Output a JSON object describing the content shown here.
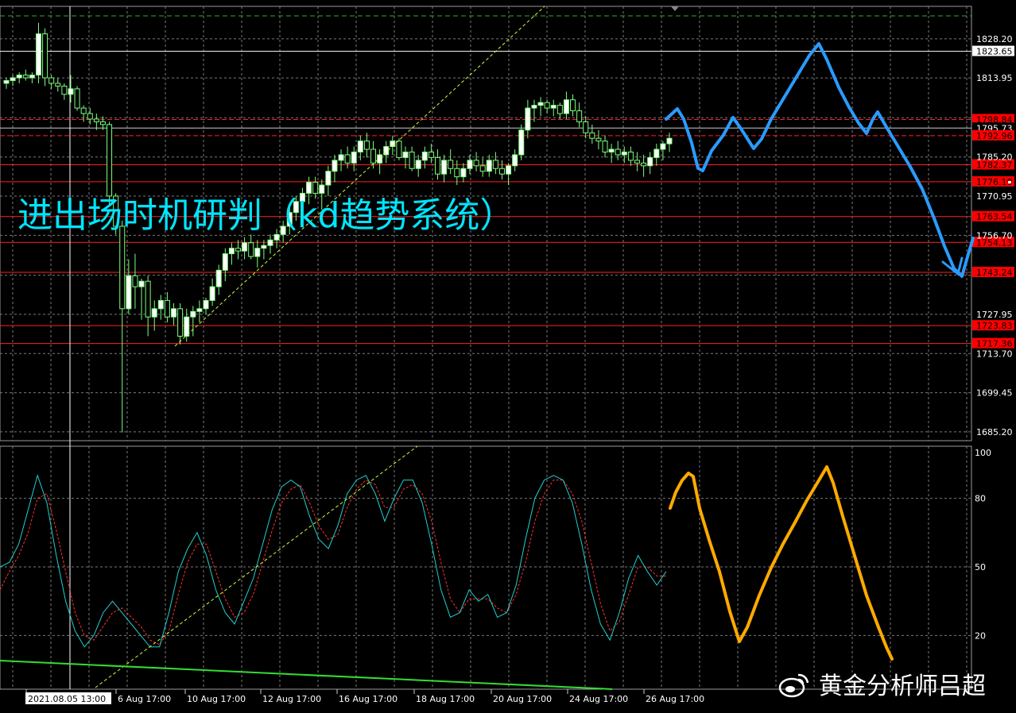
{
  "overlay_title": "进出场时机研判（kd趋势系统）",
  "watermark": "黄金分析师吕超",
  "colors": {
    "background": "#000000",
    "grid": "#7a7a7a",
    "candle": "#7dff7d",
    "candle_body_up": "#ffffff",
    "support_resistance": "#ff2020",
    "label_bg": "#ff0000",
    "current_label_bg": "#ffffff",
    "forecast_price": "#2a9bff",
    "forecast_kd": "#ffaa00",
    "kd_k": "#20d0d0",
    "kd_d": "#ff3030",
    "trendline": "#c8ff40",
    "green_line": "#33dd33",
    "overlay_text": "#00e5ff"
  },
  "chart_data": [
    {
      "type": "candlestick",
      "y_axis_ticks": [
        1828.2,
        1813.95,
        1799.45,
        1785.2,
        1770.95,
        1756.7,
        1742.2,
        1727.95,
        1713.7,
        1699.45,
        1685.2
      ],
      "y_axis_tick_labels": [
        "1828.20",
        "1813.95",
        "",
        "1785.20",
        "1770.95",
        "1756.70",
        "",
        "1727.95",
        "1713.70",
        "1699.45",
        "1685.20"
      ],
      "ylim": [
        1682,
        1840
      ],
      "x_tick_labels": [
        "2021.08.05 13:00",
        "6 Aug 17:00",
        "10 Aug 17:00",
        "12 Aug 17:00",
        "16 Aug 17:00",
        "18 Aug 17:00",
        "20 Aug 17:00",
        "24 Aug 17:00",
        "26 Aug 17:00"
      ],
      "price_levels": [
        {
          "value": 1823.65,
          "label": "1823.65",
          "style": "current"
        },
        {
          "value": 1798.84,
          "label": "1798.84",
          "style": "red"
        },
        {
          "value": 1795.73,
          "label": "1795.73",
          "style": "white"
        },
        {
          "value": 1792.96,
          "label": "1792.96",
          "style": "red"
        },
        {
          "value": 1782.37,
          "label": "1782.37",
          "style": "red"
        },
        {
          "value": 1776.19,
          "label": "1776.19",
          "style": "red"
        },
        {
          "value": 1763.54,
          "label": "1763.54",
          "style": "red"
        },
        {
          "value": 1754.13,
          "label": "1754.13",
          "style": "red"
        },
        {
          "value": 1743.24,
          "label": "1743.24",
          "style": "red"
        },
        {
          "value": 1723.83,
          "label": "1723.83",
          "style": "red"
        },
        {
          "value": 1717.36,
          "label": "1717.36",
          "style": "red"
        }
      ],
      "candles_ohlc": [
        [
          1812,
          1814,
          1810,
          1813
        ],
        [
          1813,
          1815,
          1811,
          1814
        ],
        [
          1814,
          1816,
          1812,
          1815
        ],
        [
          1815,
          1817,
          1813,
          1814
        ],
        [
          1814,
          1816,
          1812,
          1815
        ],
        [
          1815,
          1834,
          1812,
          1830
        ],
        [
          1830,
          1832,
          1811,
          1814
        ],
        [
          1814,
          1815,
          1810,
          1812
        ],
        [
          1812,
          1814,
          1809,
          1811
        ],
        [
          1811,
          1812,
          1806,
          1808
        ],
        [
          1808,
          1815,
          1805,
          1810
        ],
        [
          1810,
          1811,
          1802,
          1803
        ],
        [
          1803,
          1804,
          1798,
          1801
        ],
        [
          1801,
          1803,
          1797,
          1799
        ],
        [
          1799,
          1801,
          1795,
          1798
        ],
        [
          1798,
          1800,
          1795,
          1797
        ],
        [
          1797,
          1798,
          1768,
          1771
        ],
        [
          1771,
          1772,
          1757,
          1760
        ],
        [
          1760,
          1762,
          1685,
          1730
        ],
        [
          1730,
          1748,
          1728,
          1742
        ],
        [
          1742,
          1750,
          1730,
          1738
        ],
        [
          1738,
          1741,
          1726,
          1740
        ],
        [
          1740,
          1742,
          1720,
          1727
        ],
        [
          1727,
          1733,
          1722,
          1730
        ],
        [
          1730,
          1735,
          1726,
          1733
        ],
        [
          1733,
          1736,
          1725,
          1727
        ],
        [
          1727,
          1732,
          1724,
          1730
        ],
        [
          1730,
          1732,
          1717,
          1720
        ],
        [
          1720,
          1730,
          1718,
          1727
        ],
        [
          1727,
          1731,
          1720,
          1729
        ],
        [
          1729,
          1733,
          1725,
          1730
        ],
        [
          1730,
          1734,
          1728,
          1733
        ],
        [
          1733,
          1741,
          1731,
          1738
        ],
        [
          1738,
          1746,
          1735,
          1744
        ],
        [
          1744,
          1752,
          1740,
          1750
        ],
        [
          1750,
          1754,
          1746,
          1752
        ],
        [
          1752,
          1755,
          1748,
          1751
        ],
        [
          1751,
          1756,
          1748,
          1754
        ],
        [
          1754,
          1757,
          1748,
          1749
        ],
        [
          1749,
          1755,
          1745,
          1752
        ],
        [
          1752,
          1755,
          1748,
          1753
        ],
        [
          1753,
          1757,
          1750,
          1755
        ],
        [
          1755,
          1759,
          1752,
          1757
        ],
        [
          1757,
          1762,
          1754,
          1760
        ],
        [
          1760,
          1767,
          1757,
          1765
        ],
        [
          1765,
          1771,
          1762,
          1769
        ],
        [
          1769,
          1774,
          1765,
          1772
        ],
        [
          1772,
          1778,
          1768,
          1776
        ],
        [
          1776,
          1778,
          1770,
          1772
        ],
        [
          1772,
          1777,
          1766,
          1775
        ],
        [
          1775,
          1782,
          1771,
          1780
        ],
        [
          1780,
          1786,
          1776,
          1784
        ],
        [
          1784,
          1788,
          1780,
          1786
        ],
        [
          1786,
          1789,
          1781,
          1783
        ],
        [
          1783,
          1789,
          1780,
          1787
        ],
        [
          1787,
          1793,
          1784,
          1791
        ],
        [
          1791,
          1794,
          1785,
          1788
        ],
        [
          1788,
          1791,
          1781,
          1783
        ],
        [
          1783,
          1788,
          1779,
          1786
        ],
        [
          1786,
          1791,
          1783,
          1789
        ],
        [
          1789,
          1793,
          1786,
          1791
        ],
        [
          1791,
          1792,
          1784,
          1785
        ],
        [
          1785,
          1789,
          1781,
          1787
        ],
        [
          1787,
          1789,
          1780,
          1781
        ],
        [
          1781,
          1786,
          1778,
          1784
        ],
        [
          1784,
          1789,
          1781,
          1787
        ],
        [
          1787,
          1790,
          1783,
          1785
        ],
        [
          1785,
          1788,
          1777,
          1779
        ],
        [
          1779,
          1786,
          1776,
          1784
        ],
        [
          1784,
          1788,
          1779,
          1781
        ],
        [
          1781,
          1784,
          1775,
          1778
        ],
        [
          1778,
          1783,
          1776,
          1781
        ],
        [
          1781,
          1786,
          1779,
          1784
        ],
        [
          1784,
          1787,
          1780,
          1782
        ],
        [
          1782,
          1785,
          1778,
          1780
        ],
        [
          1780,
          1786,
          1778,
          1784
        ],
        [
          1784,
          1787,
          1779,
          1781
        ],
        [
          1781,
          1784,
          1777,
          1779
        ],
        [
          1779,
          1783,
          1775,
          1782
        ],
        [
          1782,
          1788,
          1780,
          1786
        ],
        [
          1786,
          1797,
          1784,
          1795
        ],
        [
          1795,
          1806,
          1792,
          1803
        ],
        [
          1803,
          1806,
          1798,
          1804
        ],
        [
          1804,
          1807,
          1800,
          1805
        ],
        [
          1805,
          1806,
          1801,
          1803
        ],
        [
          1803,
          1806,
          1800,
          1804
        ],
        [
          1804,
          1805,
          1799,
          1801
        ],
        [
          1801,
          1809,
          1799,
          1806
        ],
        [
          1806,
          1808,
          1800,
          1802
        ],
        [
          1802,
          1805,
          1796,
          1798
        ],
        [
          1798,
          1800,
          1792,
          1794
        ],
        [
          1794,
          1797,
          1790,
          1792
        ],
        [
          1792,
          1795,
          1788,
          1791
        ],
        [
          1791,
          1793,
          1785,
          1787
        ],
        [
          1787,
          1790,
          1783,
          1788
        ],
        [
          1788,
          1791,
          1784,
          1786
        ],
        [
          1786,
          1789,
          1783,
          1787
        ],
        [
          1787,
          1789,
          1782,
          1784
        ],
        [
          1784,
          1787,
          1780,
          1783
        ],
        [
          1783,
          1786,
          1778,
          1782
        ],
        [
          1782,
          1787,
          1779,
          1785
        ],
        [
          1785,
          1790,
          1782,
          1788
        ],
        [
          1788,
          1791,
          1784,
          1790
        ],
        [
          1790,
          1794,
          1787,
          1792
        ]
      ]
    },
    {
      "type": "line",
      "name": "stochastic",
      "y_axis_ticks": [
        100,
        80,
        50,
        20
      ],
      "ylim": [
        0,
        100
      ],
      "series": [
        {
          "values": [
            50,
            52,
            60,
            75,
            90,
            78,
            55,
            35,
            22,
            15,
            20,
            30,
            35,
            30,
            25,
            20,
            15,
            15,
            30,
            48,
            58,
            65,
            55,
            40,
            30,
            25,
            35,
            45,
            60,
            75,
            85,
            88,
            85,
            72,
            62,
            58,
            68,
            82,
            88,
            90,
            82,
            70,
            80,
            88,
            88,
            78,
            60,
            40,
            28,
            30,
            40,
            35,
            38,
            28,
            30,
            42,
            62,
            80,
            88,
            90,
            88,
            78,
            60,
            40,
            25,
            18,
            30,
            45,
            55,
            48,
            42,
            48
          ]
        },
        {
          "values": [
            40,
            48,
            55,
            65,
            80,
            82,
            66,
            48,
            30,
            20,
            18,
            24,
            30,
            32,
            28,
            24,
            18,
            16,
            22,
            38,
            52,
            60,
            60,
            48,
            36,
            28,
            30,
            38,
            52,
            66,
            78,
            84,
            86,
            78,
            68,
            62,
            64,
            76,
            84,
            88,
            86,
            76,
            76,
            84,
            86,
            82,
            70,
            52,
            36,
            30,
            36,
            36,
            36,
            32,
            30,
            38,
            52,
            70,
            82,
            88,
            88,
            82,
            70,
            52,
            34,
            22,
            26,
            38,
            50,
            50,
            46,
            46
          ]
        }
      ]
    }
  ]
}
